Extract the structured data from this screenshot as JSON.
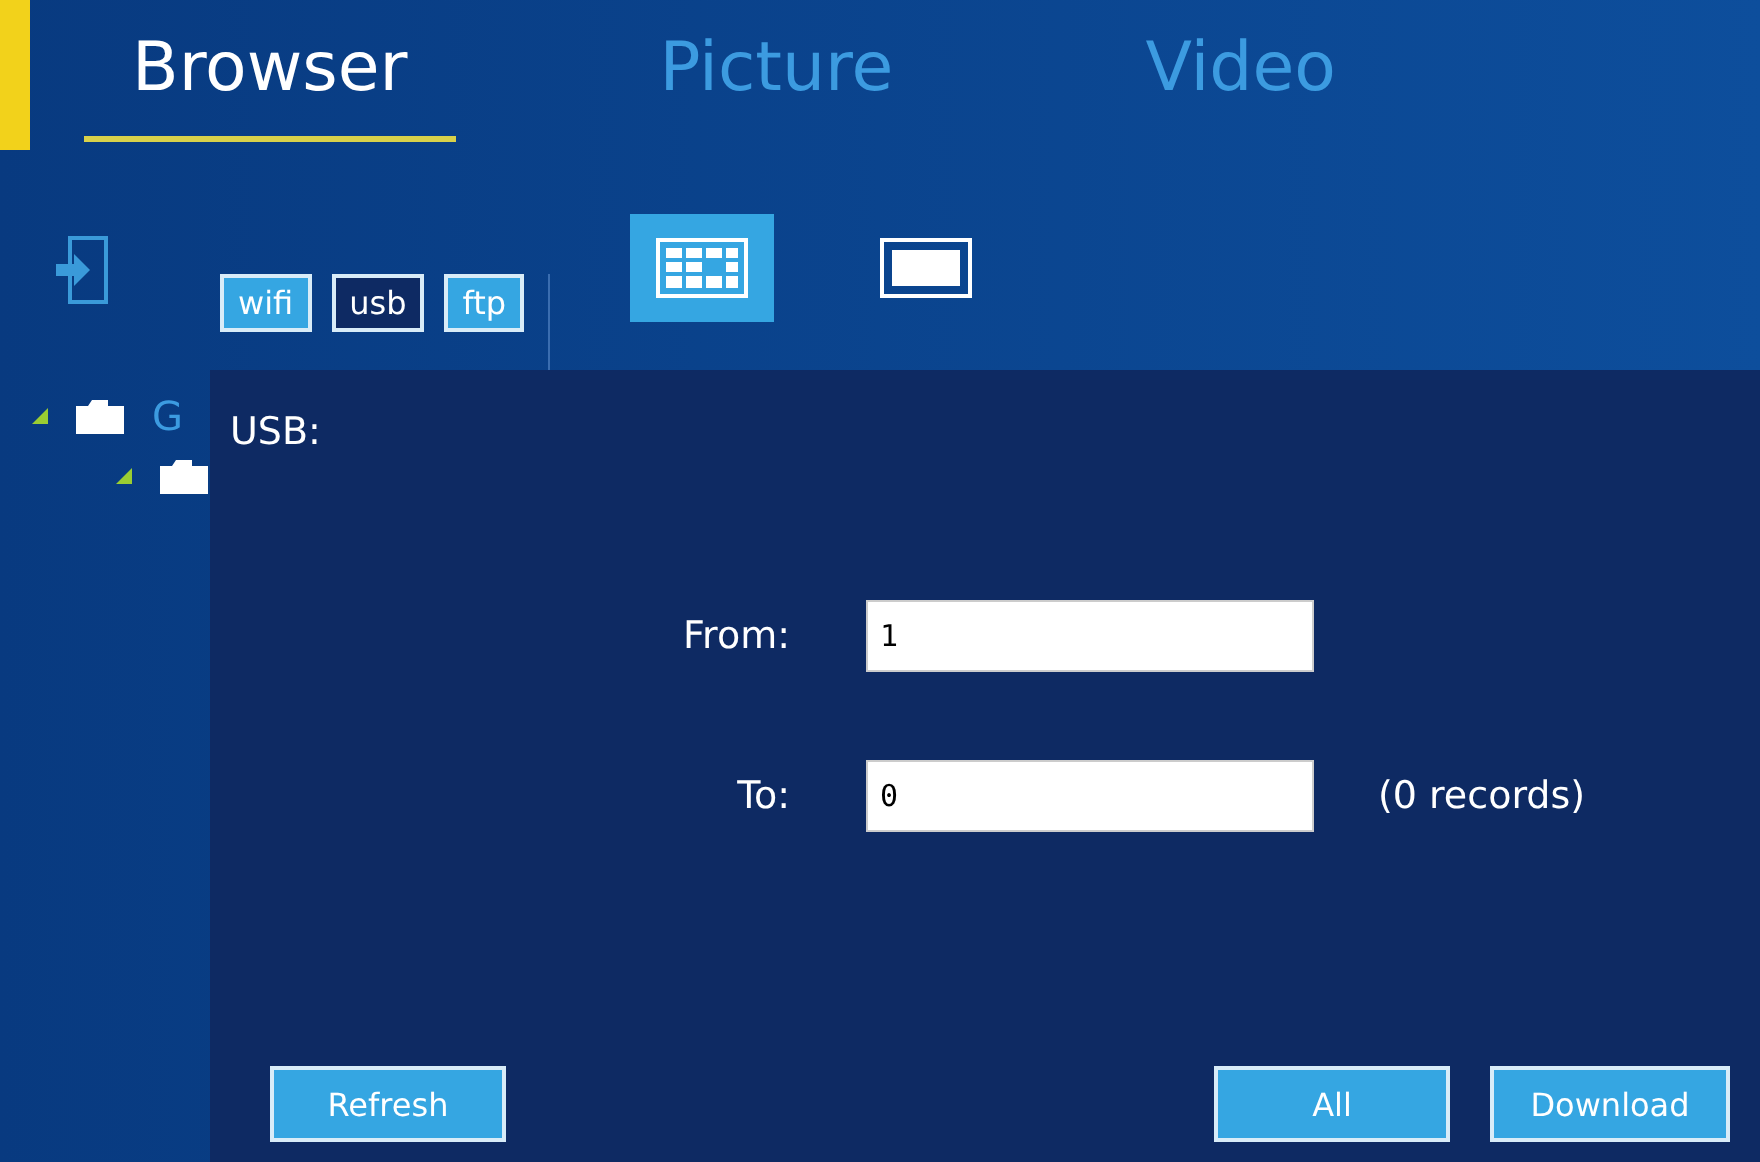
{
  "tabs": [
    {
      "label": "Browser",
      "selected": true
    },
    {
      "label": "Picture",
      "selected": false
    },
    {
      "label": "Video",
      "selected": false
    }
  ],
  "sources": [
    {
      "label": "wifi",
      "selected": false
    },
    {
      "label": "usb",
      "selected": true
    },
    {
      "label": "ftp",
      "selected": false
    }
  ],
  "view_modes": [
    {
      "kind": "grid",
      "selected": true
    },
    {
      "kind": "single",
      "selected": false
    }
  ],
  "tree": [
    {
      "label": "G",
      "expanded": true,
      "children": [
        {
          "expanded": true
        }
      ]
    }
  ],
  "panel": {
    "title": "USB:",
    "from": {
      "label": "From:",
      "value": "1"
    },
    "to": {
      "label": "To:",
      "value": "0"
    },
    "records": "(0 records)",
    "buttons": {
      "refresh": "Refresh",
      "all": "All",
      "download": "Download"
    }
  }
}
